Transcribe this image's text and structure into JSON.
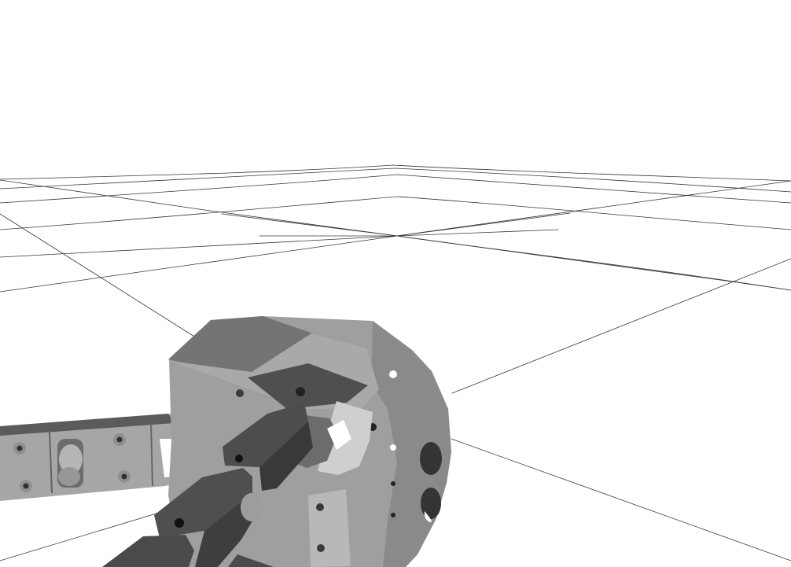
{
  "viewport": {
    "background": "#ffffff",
    "grid_color": "#222222",
    "model_color_light": "#b5b5b5",
    "model_color_mid": "#8c8c8c",
    "model_color_dark": "#4d4d4d"
  },
  "scene": {
    "floor_grid": "floor-grid",
    "model": "robot-gripper"
  }
}
